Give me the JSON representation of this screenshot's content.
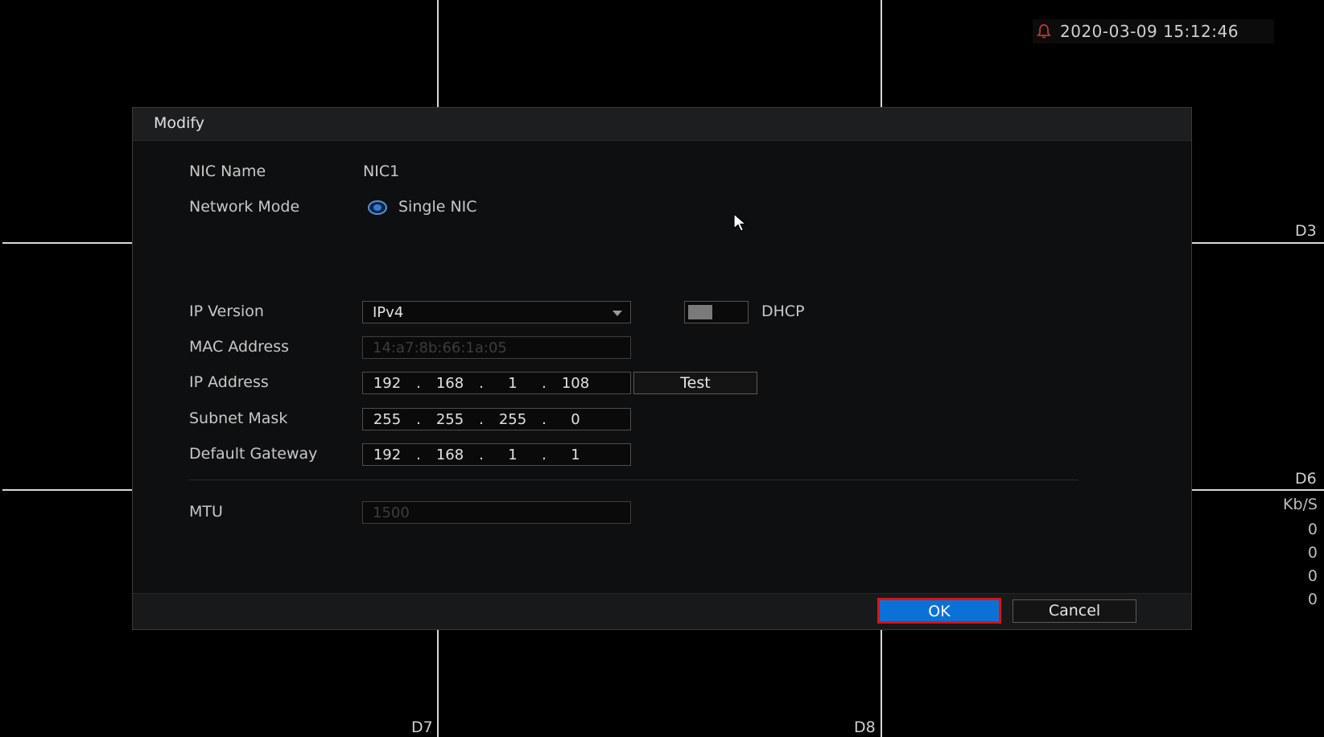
{
  "clock": {
    "datetime": "2020-03-09 15:12:46"
  },
  "channels": {
    "d3": "D3",
    "d6": "D6",
    "d7": "D7",
    "d8": "D8"
  },
  "bitrate": {
    "unit": "Kb/S",
    "values": [
      "0",
      "0",
      "0",
      "0"
    ]
  },
  "dialog": {
    "title": "Modify",
    "labels": {
      "nic_name": "NIC Name",
      "network_mode": "Network Mode",
      "ip_version": "IP Version",
      "mac_address": "MAC Address",
      "ip_address": "IP Address",
      "subnet_mask": "Subnet Mask",
      "default_gateway": "Default Gateway",
      "mtu": "MTU"
    },
    "nic_name": "NIC1",
    "network_mode": "Single NIC",
    "ip_version": "IPv4",
    "dhcp_label": "DHCP",
    "dhcp_enabled": false,
    "mac_address": "14:a7:8b:66:1a:05",
    "ip_address": [
      "192",
      "168",
      "1",
      "108"
    ],
    "subnet_mask": [
      "255",
      "255",
      "255",
      "0"
    ],
    "default_gateway": [
      "192",
      "168",
      "1",
      "1"
    ],
    "mtu": "1500",
    "test_label": "Test",
    "ok_label": "OK",
    "cancel_label": "Cancel"
  },
  "colors": {
    "ok_button": "#0a72d6",
    "ok_highlight": "#e01010",
    "radio_accent": "#2f7de0",
    "alarm_bell": "#c0392b"
  },
  "icons": [
    "bell-icon",
    "dropdown-arrow-icon",
    "mouse-pointer-icon"
  ]
}
